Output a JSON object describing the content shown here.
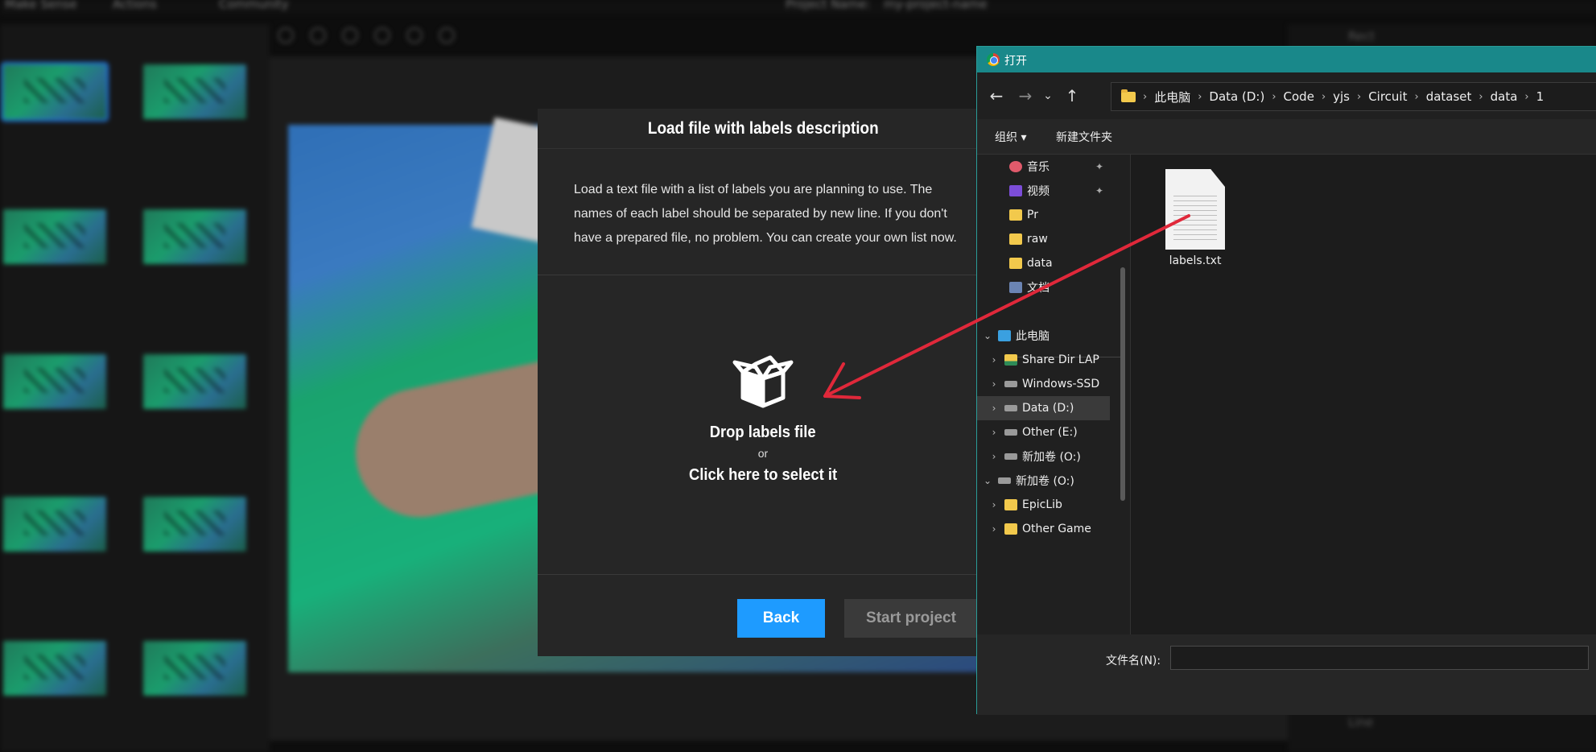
{
  "app": {
    "menu": [
      "Make Sense",
      "Actions",
      "Community"
    ],
    "project_label": "Project Name:",
    "project_value": "my-project-name",
    "right_panel_items": [
      "Rect",
      "Line"
    ]
  },
  "modal": {
    "title": "Load file with labels description",
    "description": "Load a text file with a list of labels you are planning to use. The names of each label should be separated by new line. If you don't have a prepared file, no problem. You can create your own list now.",
    "drop_main": "Drop labels file",
    "drop_or": "or",
    "drop_click": "Click here to select it",
    "icon": "box-open-icon",
    "back_label": "Back",
    "start_label": "Start project",
    "colors": {
      "accent": "#1e9bff",
      "panel": "#262626"
    }
  },
  "dialog": {
    "title": "打开",
    "breadcrumb": [
      "此电脑",
      "Data (D:)",
      "Code",
      "yjs",
      "Circuit",
      "dataset",
      "data",
      "1"
    ],
    "toolbar": {
      "organize": "组织 ▾",
      "new_folder": "新建文件夹"
    },
    "nav_items": [
      {
        "label": "音乐",
        "icon": "music-icon",
        "pinned": true
      },
      {
        "label": "视频",
        "icon": "video-icon",
        "pinned": true
      },
      {
        "label": "Pr",
        "icon": "folder-icon"
      },
      {
        "label": "raw",
        "icon": "folder-icon"
      },
      {
        "label": "data",
        "icon": "folder-icon"
      },
      {
        "label": "文档",
        "icon": "document-icon"
      },
      {
        "label": "此电脑",
        "icon": "pc-icon",
        "expanded": true
      },
      {
        "label": "Share Dir LAP",
        "icon": "share-folder-icon"
      },
      {
        "label": "Windows-SSD",
        "icon": "drive-icon"
      },
      {
        "label": "Data (D:)",
        "icon": "drive-icon",
        "selected": true
      },
      {
        "label": "Other (E:)",
        "icon": "drive-icon"
      },
      {
        "label": "新加卷 (O:)",
        "icon": "drive-icon"
      },
      {
        "label": "新加卷 (O:)",
        "icon": "drive-icon",
        "expanded": true
      },
      {
        "label": "EpicLib",
        "icon": "folder-icon"
      },
      {
        "label": "Other Game",
        "icon": "folder-icon"
      }
    ],
    "files": [
      {
        "name": "labels.txt",
        "icon": "text-file-icon"
      }
    ],
    "filename_label": "文件名(N):",
    "filename_value": "",
    "accent": "#19888a"
  },
  "annotation": {
    "arrow_color": "#e0283a"
  }
}
